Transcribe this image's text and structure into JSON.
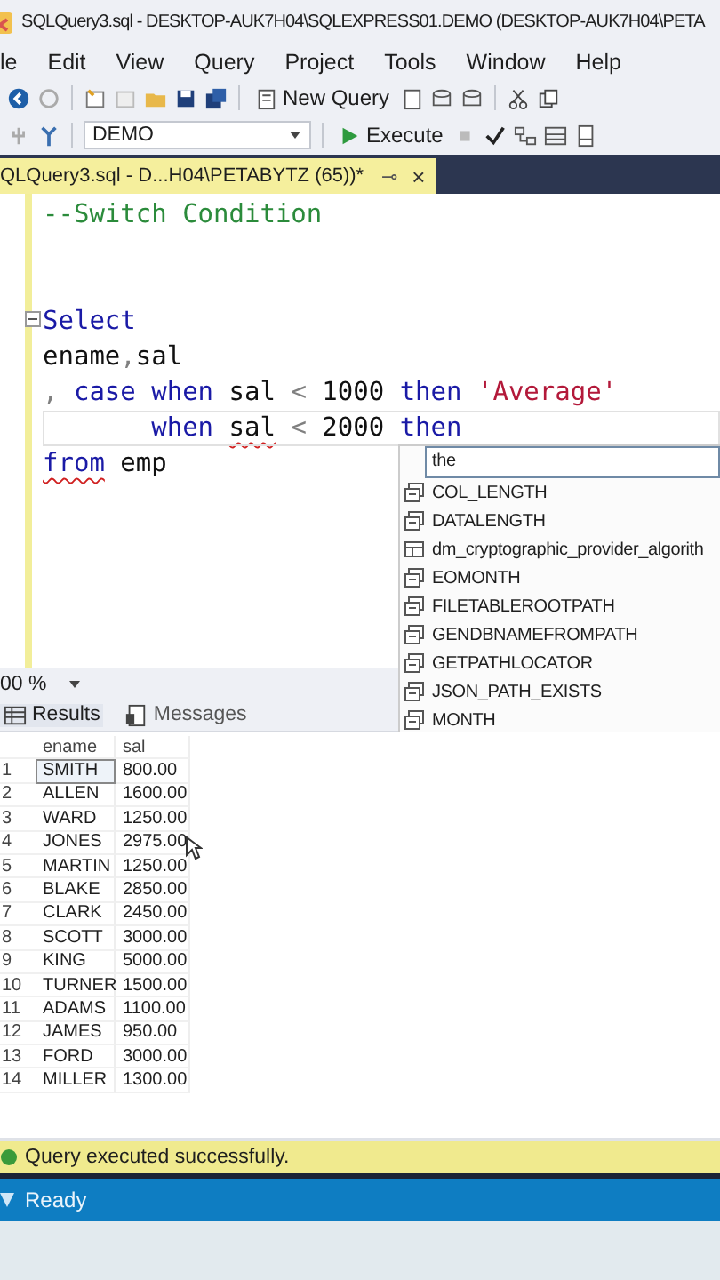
{
  "window": {
    "title": "SQLQuery3.sql - DESKTOP-AUK7H04\\SQLEXPRESS01.DEMO (DESKTOP-AUK7H04\\PETA"
  },
  "menu": [
    "le",
    "Edit",
    "View",
    "Query",
    "Project",
    "Tools",
    "Window",
    "Help"
  ],
  "toolbar": {
    "new_query": "New Query",
    "database": "DEMO",
    "execute": "Execute"
  },
  "tab": {
    "title": "QLQuery3.sql - D...H04\\PETABYTZ (65))*",
    "pin": "⊸",
    "close": "×"
  },
  "editor": {
    "lines": [
      {
        "current": false,
        "tokens": [
          {
            "text": "--Switch Condition",
            "kind": "comment",
            "error": false
          }
        ]
      },
      {
        "current": false
      },
      {
        "current": false
      },
      {
        "current": false,
        "tokens": [
          {
            "text": "Select",
            "kind": "keyword",
            "error": false
          }
        ]
      },
      {
        "current": false,
        "tokens": [
          {
            "text": "ename",
            "kind": "plain",
            "error": false
          },
          {
            "text": ",",
            "kind": "punct",
            "error": false
          },
          {
            "text": "sal",
            "kind": "plain",
            "error": false
          }
        ]
      },
      {
        "current": false,
        "tokens": [
          {
            "text": ",",
            "kind": "punct",
            "error": false
          },
          {
            "text": " case",
            "kind": "keyword",
            "error": false
          },
          {
            "text": " when",
            "kind": "keyword",
            "error": false
          },
          {
            "text": " sal",
            "kind": "plain",
            "error": false
          },
          {
            "text": " <",
            "kind": "punct",
            "error": false
          },
          {
            "text": " 1000",
            "kind": "plain",
            "error": false
          },
          {
            "text": " then",
            "kind": "keyword",
            "error": false
          },
          {
            "text": " 'Average'",
            "kind": "string",
            "error": false
          }
        ]
      },
      {
        "current": true,
        "tokens": [
          {
            "text": "       when ",
            "kind": "keyword",
            "error": false
          },
          {
            "text": "sal",
            "kind": "plain",
            "error": true
          },
          {
            "text": " <",
            "kind": "punct",
            "error": false
          },
          {
            "text": " 2000",
            "kind": "plain",
            "error": false
          },
          {
            "text": " then",
            "kind": "keyword",
            "error": false
          }
        ]
      },
      {
        "current": false,
        "tokens": [
          {
            "text": "from",
            "kind": "keyword",
            "error": true
          },
          {
            "text": " emp",
            "kind": "plain",
            "error": false
          }
        ]
      }
    ]
  },
  "autocomplete": {
    "input": "the",
    "items": [
      {
        "label": "COL_LENGTH",
        "kind": "function"
      },
      {
        "label": "DATALENGTH",
        "kind": "function"
      },
      {
        "label": "dm_cryptographic_provider_algorith",
        "kind": "table"
      },
      {
        "label": "EOMONTH",
        "kind": "function"
      },
      {
        "label": "FILETABLEROOTPATH",
        "kind": "function"
      },
      {
        "label": "GENDBNAMEFROMPATH",
        "kind": "function"
      },
      {
        "label": "GETPATHLOCATOR",
        "kind": "function"
      },
      {
        "label": "JSON_PATH_EXISTS",
        "kind": "function"
      },
      {
        "label": "MONTH",
        "kind": "function"
      }
    ]
  },
  "zoom": "00 %",
  "result_tabs": [
    {
      "label": "Results",
      "selected": true
    },
    {
      "label": "Messages",
      "selected": false
    }
  ],
  "grid": {
    "columns": [
      "ename",
      "sal"
    ],
    "rows": [
      {
        "n": "1",
        "ename": "SMITH",
        "sal": "800.00",
        "selected": true
      },
      {
        "n": "2",
        "ename": "ALLEN",
        "sal": "1600.00",
        "selected": false
      },
      {
        "n": "3",
        "ename": "WARD",
        "sal": "1250.00",
        "selected": false
      },
      {
        "n": "4",
        "ename": "JONES",
        "sal": "2975.00",
        "selected": false
      },
      {
        "n": "5",
        "ename": "MARTIN",
        "sal": "1250.00",
        "selected": false
      },
      {
        "n": "6",
        "ename": "BLAKE",
        "sal": "2850.00",
        "selected": false
      },
      {
        "n": "7",
        "ename": "CLARK",
        "sal": "2450.00",
        "selected": false
      },
      {
        "n": "8",
        "ename": "SCOTT",
        "sal": "3000.00",
        "selected": false
      },
      {
        "n": "9",
        "ename": "KING",
        "sal": "5000.00",
        "selected": false
      },
      {
        "n": "10",
        "ename": "TURNER",
        "sal": "1500.00",
        "selected": false
      },
      {
        "n": "11",
        "ename": "ADAMS",
        "sal": "1100.00",
        "selected": false
      },
      {
        "n": "12",
        "ename": "JAMES",
        "sal": "950.00",
        "selected": false
      },
      {
        "n": "13",
        "ename": "FORD",
        "sal": "3000.00",
        "selected": false
      },
      {
        "n": "14",
        "ename": "MILLER",
        "sal": "1300.00",
        "selected": false
      }
    ]
  },
  "message": "Query executed successfully.",
  "status": "Ready"
}
